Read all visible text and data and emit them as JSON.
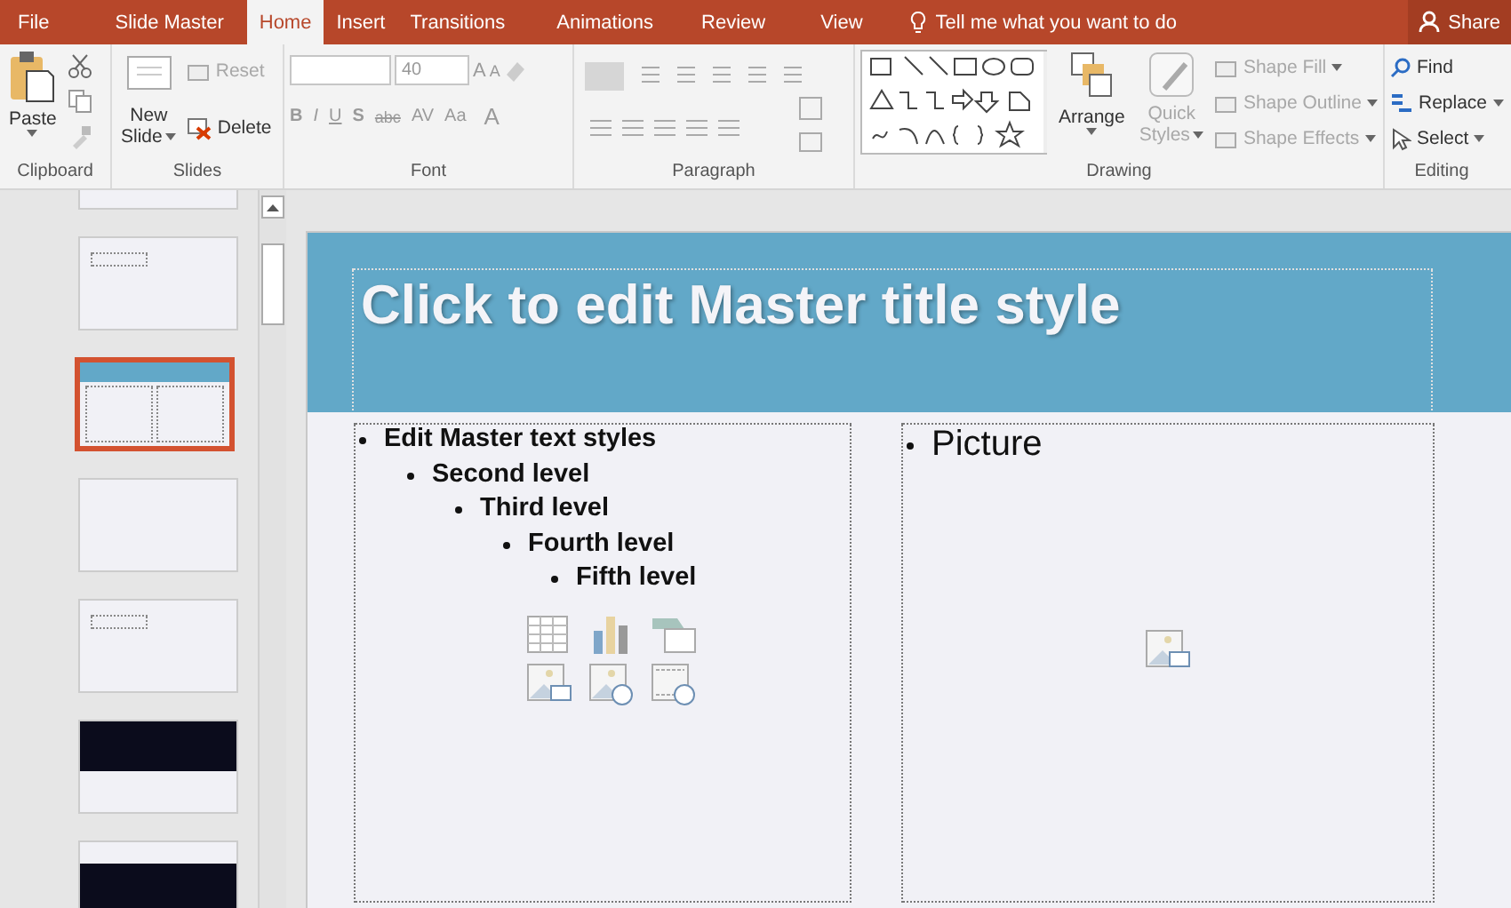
{
  "tabs": [
    {
      "label": "File",
      "selected": false
    },
    {
      "label": "Slide Master",
      "selected": false
    },
    {
      "label": "Home",
      "selected": true
    },
    {
      "label": "Insert",
      "selected": false
    },
    {
      "label": "Transitions",
      "selected": false
    },
    {
      "label": "Animations",
      "selected": false
    },
    {
      "label": "Review",
      "selected": false
    },
    {
      "label": "View",
      "selected": false
    }
  ],
  "tell_me": "Tell me what you want to do",
  "share": "Share",
  "ribbon": {
    "clipboard": {
      "label": "Clipboard",
      "paste": "Paste"
    },
    "slides": {
      "label": "Slides",
      "new_slide": [
        "New",
        "Slide"
      ],
      "reset": {
        "label": "Reset",
        "disabled": true
      },
      "delete": {
        "label": "Delete",
        "disabled": false
      }
    },
    "font": {
      "label": "Font",
      "disabled": true,
      "font_size": "40",
      "grow": "A",
      "shrink": "A",
      "styles": [
        "B",
        "I",
        "U",
        "S",
        "abc",
        "AV",
        "Aa"
      ],
      "font_color_button": "A"
    },
    "paragraph": {
      "label": "Paragraph"
    },
    "drawing": {
      "label": "Drawing",
      "arrange": "Arrange",
      "quick_styles": [
        "Quick",
        "Styles"
      ],
      "shape_buttons": [
        {
          "label": "Shape Fill",
          "disabled": true
        },
        {
          "label": "Shape Outline",
          "disabled": true
        },
        {
          "label": "Shape Effects",
          "disabled": true
        }
      ]
    },
    "editing": {
      "label": "Editing",
      "items": [
        {
          "kind": "find",
          "label": "Find"
        },
        {
          "kind": "replace",
          "label": "Replace"
        },
        {
          "kind": "select",
          "label": "Select"
        }
      ]
    }
  },
  "thumbnails": [
    {
      "kind": "blank",
      "selected": false
    },
    {
      "kind": "title",
      "selected": false
    },
    {
      "kind": "layout",
      "selected": true
    },
    {
      "kind": "blank",
      "selected": false
    },
    {
      "kind": "title",
      "selected": false
    },
    {
      "kind": "dark",
      "selected": false
    },
    {
      "kind": "dark-bottom",
      "selected": false
    }
  ],
  "slide": {
    "title": "Click to edit Master title style",
    "bullets": [
      {
        "text": "Edit Master text styles",
        "children": [
          {
            "text": "Second level",
            "children": [
              {
                "text": "Third level",
                "children": [
                  {
                    "text": "Fourth level",
                    "children": [
                      {
                        "text": "Fifth level"
                      }
                    ]
                  }
                ]
              }
            ]
          }
        ]
      }
    ],
    "picture_placeholder": "Picture"
  }
}
